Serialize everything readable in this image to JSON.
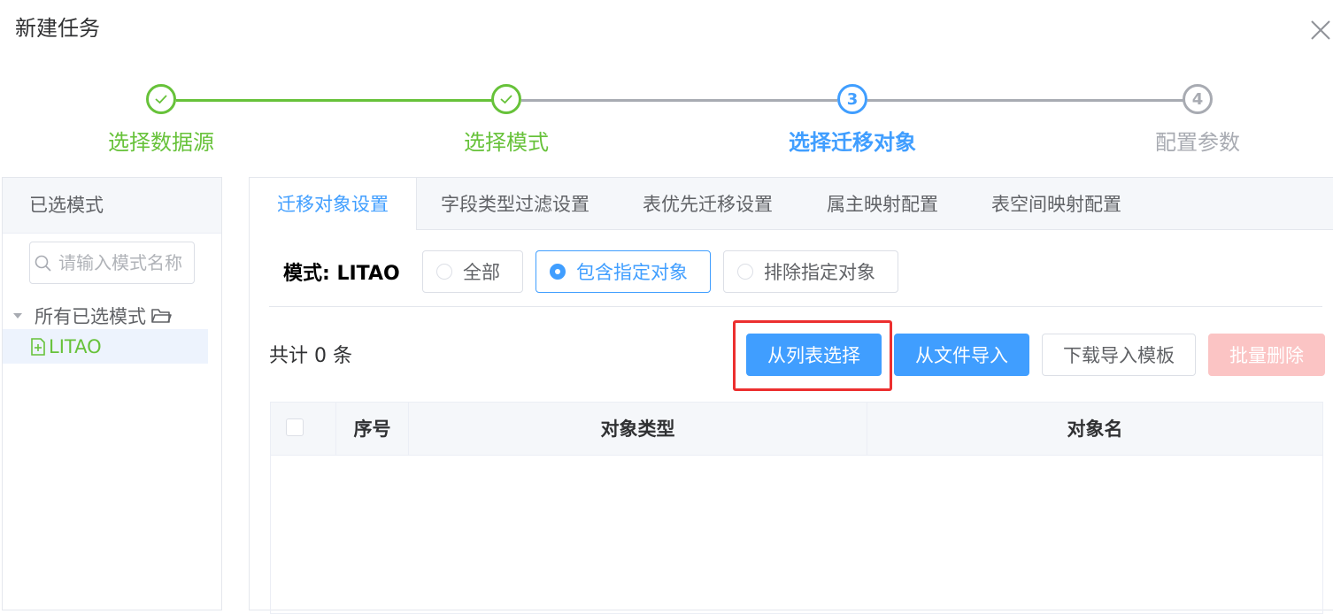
{
  "dialog": {
    "title": "新建任务"
  },
  "steps": [
    {
      "number": "1",
      "title": "选择数据源",
      "status": "finished"
    },
    {
      "number": "2",
      "title": "选择模式",
      "status": "finished"
    },
    {
      "number": "3",
      "title": "选择迁移对象",
      "status": "active"
    },
    {
      "number": "4",
      "title": "配置参数",
      "status": "pending"
    }
  ],
  "sidebar": {
    "header": "已选模式",
    "search_placeholder": "请输入模式名称",
    "tree_root": "所有已选模式",
    "tree_child": "LITAO"
  },
  "tabs": [
    {
      "label": "迁移对象设置",
      "active": true
    },
    {
      "label": "字段类型过滤设置",
      "active": false
    },
    {
      "label": "表优先迁移设置",
      "active": false
    },
    {
      "label": "属主映射配置",
      "active": false
    },
    {
      "label": "表空间映射配置",
      "active": false
    }
  ],
  "mode": {
    "label": "模式: LITAO",
    "options": [
      {
        "label": "全部",
        "checked": false
      },
      {
        "label": "包含指定对象",
        "checked": true
      },
      {
        "label": "排除指定对象",
        "checked": false
      }
    ]
  },
  "toolbar": {
    "total_text": "共计 0 条",
    "select_from_list": "从列表选择",
    "import_from_file": "从文件导入",
    "download_template": "下载导入模板",
    "batch_delete": "批量删除"
  },
  "table": {
    "columns": [
      "序号",
      "对象类型",
      "对象名"
    ],
    "rows": []
  },
  "colors": {
    "finished": "#67c23a",
    "active": "#409eff",
    "pending": "#a8abb2",
    "highlight": "#ec2f2f",
    "danger_disabled": "#fbc4c4"
  },
  "icons": {
    "close": "close-icon",
    "check": "check-icon",
    "search": "search-icon",
    "caret": "caret-down-icon",
    "folder": "folder-icon",
    "file": "file-add-icon"
  }
}
